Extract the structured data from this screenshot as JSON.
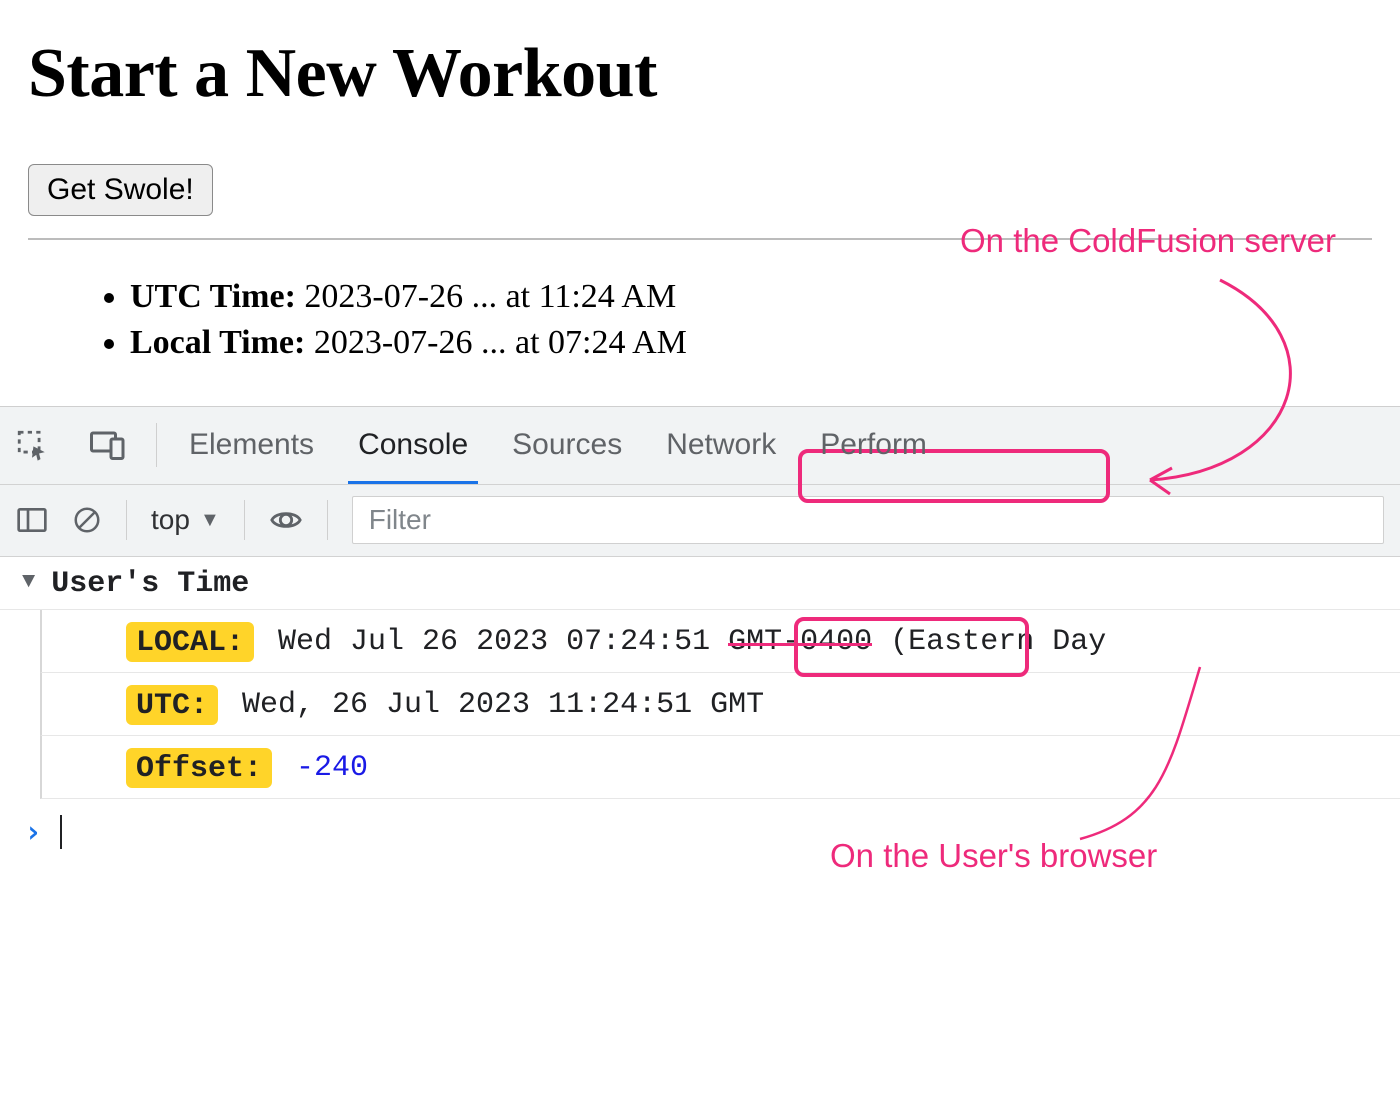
{
  "page": {
    "title": "Start a New Workout",
    "button": "Get Swole!",
    "times": {
      "utc_label": "UTC Time:",
      "utc_value": "2023-07-26 ... at 11:24 AM",
      "local_label": "Local Time:",
      "local_value_prefix": "2023-07-26 ... ",
      "local_value_highlight": "at 07:24 AM"
    }
  },
  "annotations": {
    "server_note": "On the ColdFusion server",
    "browser_note": "On the User's browser"
  },
  "devtools": {
    "tabs": {
      "elements": "Elements",
      "console": "Console",
      "sources": "Sources",
      "network": "Network",
      "performance": "Perform"
    },
    "toolbar": {
      "context": "top",
      "filter_placeholder": "Filter"
    },
    "console": {
      "group_title": "User's Time",
      "rows": {
        "local_tag": "LOCAL:",
        "local_date": "Wed Jul 26 2023",
        "local_time_highlight": "07:24:51",
        "local_tz_strike": "GMT-0400",
        "local_tz_rest": " (Eastern Day",
        "utc_tag": "UTC:",
        "utc_value": "Wed, 26 Jul 2023 11:24:51 GMT",
        "offset_tag": "Offset:",
        "offset_value": "-240"
      }
    }
  }
}
